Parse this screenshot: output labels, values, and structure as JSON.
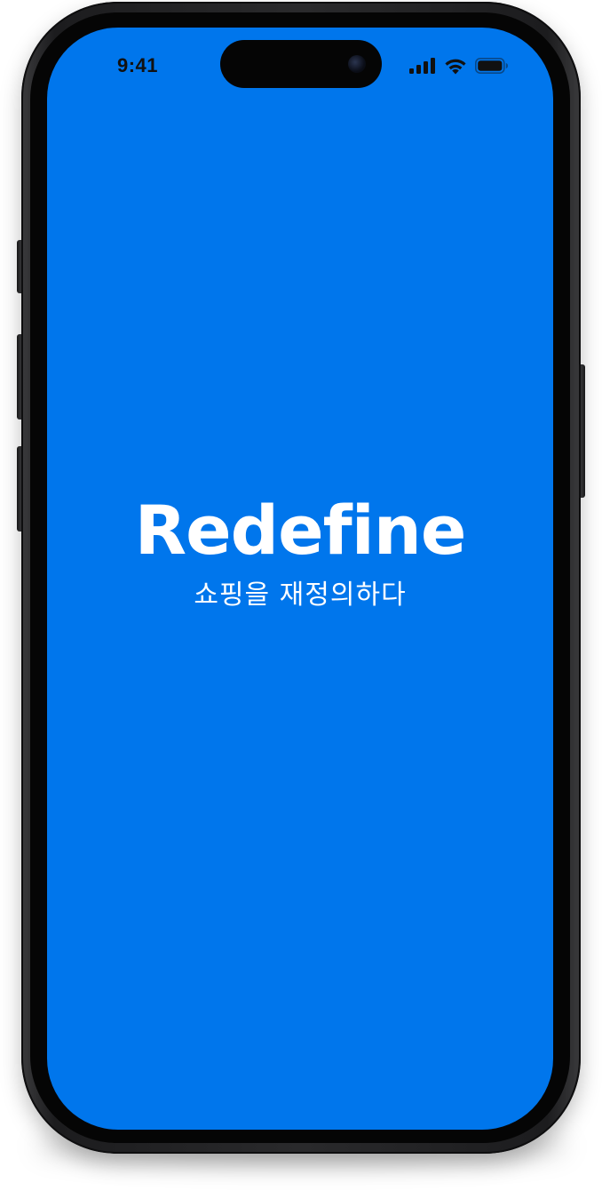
{
  "status_bar": {
    "time": "9:41",
    "icons": [
      "cellular-signal-icon",
      "wifi-icon",
      "battery-icon"
    ]
  },
  "splash": {
    "brand_name": "Redefine",
    "tagline": "쇼핑을 재정의하다"
  },
  "colors": {
    "screen_background": "#0076EC",
    "brand_text": "#FFFFFF",
    "status_text": "#111111"
  }
}
